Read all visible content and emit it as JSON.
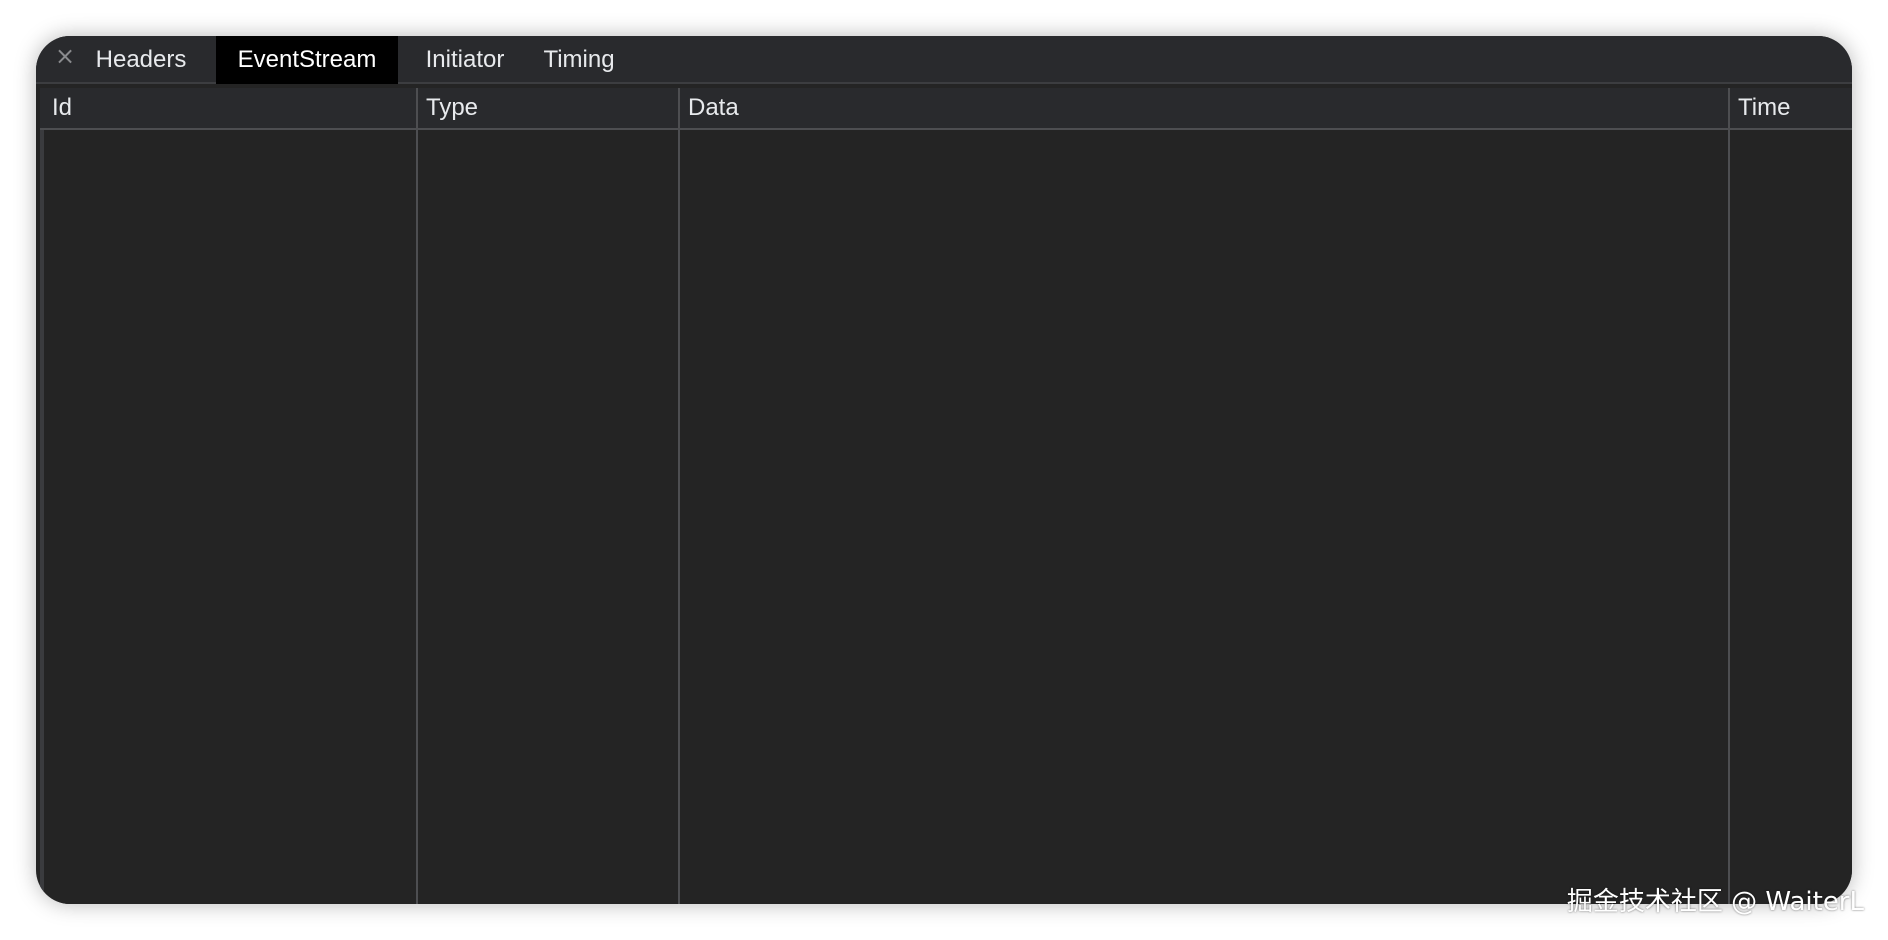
{
  "tabs": {
    "close_glyph": "×",
    "items": [
      {
        "label": "Headers",
        "active": false
      },
      {
        "label": "EventStream",
        "active": true
      },
      {
        "label": "Initiator",
        "active": false
      },
      {
        "label": "Timing",
        "active": false
      }
    ]
  },
  "table": {
    "columns": [
      "Id",
      "Type",
      "Data",
      "Time"
    ],
    "rows": []
  },
  "watermark": "掘金技术社区 @ WaiterL",
  "colors": {
    "panel_bg": "#242424",
    "tabbar_bg": "#292a2d",
    "active_tab_bg": "#000000",
    "grid_line": "#4d4e51",
    "text": "#e8eaed"
  }
}
